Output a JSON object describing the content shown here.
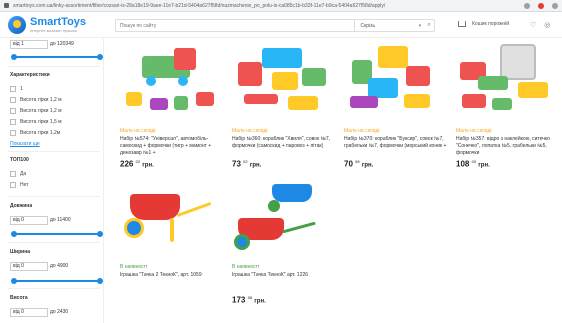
{
  "browser": {
    "url": "smarttoys.com.ua/linky-assortiment/filter/cozsari-is-28a18e19-9aee-11e7-b21d-5404a627f58d/nazmachenie_po_polu-is-ca085c1b-b33f-11e7-b9ca-5404a627f58d/apply/"
  },
  "header": {
    "logo_name": "SmartToys",
    "logo_sub": "інтернет-магазин іграшок",
    "search_placeholder": "Пошук по сайту",
    "search_category": "Скрізь",
    "cart_label": "Кошик порожній"
  },
  "filters": {
    "price": {
      "from_label": "від 1",
      "to_label": "до 120349",
      "slider_min_fraction": 0,
      "slider_max_fraction": 1
    },
    "characteristics": {
      "title": "Характеристики",
      "items": [
        "1",
        "Висота гірки 1,2 м",
        "Висота гірки 1,2 м",
        "Висота гірки 1,5 м",
        "Висота гірки 1,2м"
      ],
      "more": "Показати ще"
    },
    "top100": {
      "title": "ТОП100",
      "items": [
        "Да",
        "Нет"
      ]
    },
    "length": {
      "title": "Довжина",
      "from_label": "від 0",
      "to_label": "до 11400",
      "slider_min_fraction": 0,
      "slider_max_fraction": 1
    },
    "width": {
      "title": "Ширина",
      "from_label": "від 0",
      "to_label": "до 4900",
      "slider_min_fraction": 0,
      "slider_max_fraction": 1
    },
    "height": {
      "title": "Висота",
      "from_label": "від 0",
      "to_label": "до 2430",
      "slider_min_fraction": 0,
      "slider_max_fraction": 1
    }
  },
  "products": [
    {
      "stock": "Мало на складі",
      "stock_status": "low",
      "name": "Набір №574: \"Універсал\", автомобіль-самоскид + формочки (тигр + мамонт + динозавр №1 +",
      "price_main": "226",
      "price_cents": "02",
      "currency": "грн."
    },
    {
      "stock": "Мало на складі",
      "stock_status": "low",
      "name": "Набір №360: кораблик \"Хвиля\", совок №7, формочки (самоскид + паровоз + літак)",
      "price_main": "73",
      "price_cents": "02",
      "currency": "грн."
    },
    {
      "stock": "Мало на складі",
      "stock_status": "low",
      "name": "Набір №370: кораблик \"Буксир\", совок №7, грабельки №7, формочки (морський коник +",
      "price_main": "70",
      "price_cents": "98",
      "currency": "грн."
    },
    {
      "stock": "Мало на складі",
      "stock_status": "low",
      "name": "Набір №357: відро з наклейкою, ситечко \"Сонечко\", лопатка №5, грабельки №5, формочки",
      "price_main": "108",
      "price_cents": "00",
      "currency": "грн."
    },
    {
      "stock": "В наявності",
      "stock_status": "ok",
      "name": "Іграшка \"Тачка 2 ТекноК\", арт. 1059",
      "price_main": "",
      "price_cents": "",
      "currency": ""
    },
    {
      "stock": "В наявності",
      "stock_status": "ok",
      "name": "Іграшка \"Тачка ТекноК\" арт. 1226",
      "price_main": "173",
      "price_cents": "58",
      "currency": "грн."
    }
  ],
  "colors": {
    "accent": "#1e88e5",
    "low_stock": "#f9a825",
    "in_stock": "#43a047"
  }
}
